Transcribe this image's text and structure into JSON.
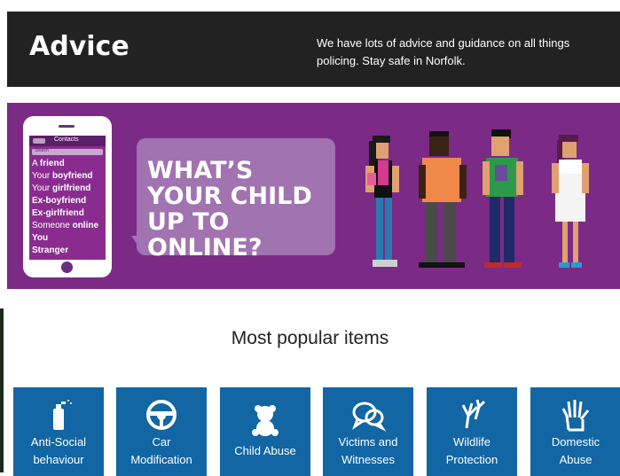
{
  "header": {
    "title": "Advice",
    "description": "We have lots of advice and guidance on all things policing. Stay safe in Norfolk."
  },
  "banner": {
    "phone": {
      "header_label": "Contacts",
      "search_placeholder": "Search",
      "contacts": [
        {
          "plain": "A ",
          "bold": "friend"
        },
        {
          "plain": "Your ",
          "bold": "boyfriend"
        },
        {
          "plain": "Your ",
          "bold": "girlfriend"
        },
        {
          "plain": "",
          "bold": "Ex-boyfriend"
        },
        {
          "plain": "",
          "bold": "Ex-girlfriend"
        },
        {
          "plain": "Someone ",
          "bold": "online"
        },
        {
          "plain": "",
          "bold": "You"
        },
        {
          "plain": "",
          "bold": "Stranger"
        }
      ]
    },
    "headline": "WHAT’S YOUR CHILD UP TO ONLINE?",
    "colors": {
      "background": "#7b2a86",
      "bubble": "#a173b0"
    }
  },
  "popular": {
    "title": "Most popular items",
    "items": [
      {
        "label_line1": "Anti-Social",
        "label_line2": "behaviour",
        "icon": "spray-can-icon"
      },
      {
        "label_line1": "Car",
        "label_line2": "Modification",
        "icon": "steering-wheel-icon"
      },
      {
        "label_line1": "Child Abuse",
        "label_line2": "",
        "icon": "teddy-bear-icon"
      },
      {
        "label_line1": "Victims and",
        "label_line2": "Witnesses",
        "icon": "speech-bubbles-icon"
      },
      {
        "label_line1": "Wildlife",
        "label_line2": "Protection",
        "icon": "bird-claw-icon"
      },
      {
        "label_line1": "Domestic",
        "label_line2": "Abuse",
        "icon": "raised-hand-icon"
      }
    ],
    "tile_color": "#1166a3"
  }
}
